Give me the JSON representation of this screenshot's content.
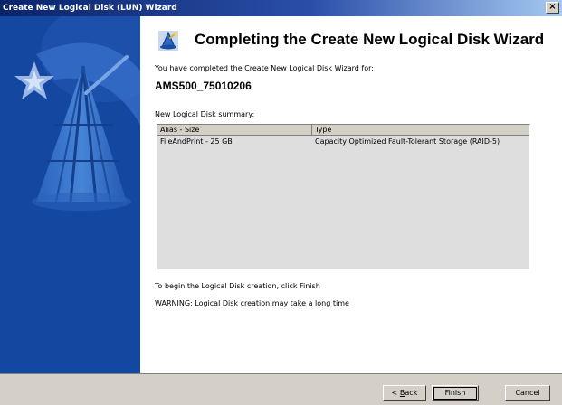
{
  "window": {
    "title": "Create New Logical Disk (LUN) Wizard",
    "close_glyph": "×"
  },
  "page": {
    "heading": "Completing the Create New Logical Disk Wizard",
    "intro": "You have completed the Create New Logical Disk Wizard for:",
    "disk_name": "AMS500_75010206",
    "summary_label": "New Logical Disk summary:",
    "hint_finish": "To begin the Logical Disk creation, click Finish",
    "warning": "WARNING: Logical Disk creation may take a long time"
  },
  "summary_table": {
    "columns": [
      "Alias - Size",
      "Type"
    ],
    "rows": [
      [
        "FileAndPrint - 25 GB",
        "Capacity Optimized Fault-Tolerant Storage  (RAID-5)"
      ]
    ]
  },
  "buttons": {
    "back_prefix": "< ",
    "back_access": "B",
    "back_rest": "ack",
    "finish": "Finish",
    "cancel": "Cancel"
  },
  "colors": {
    "title_bar": "#0a246a",
    "sidebar": "#1a54ad",
    "dialog_face": "#d4d0c8",
    "list_bg": "#dedede"
  },
  "icons": {
    "wizard_icon": "wizard-hat-icon",
    "sidebar_art": "wizard-wand-hat-illustration"
  }
}
